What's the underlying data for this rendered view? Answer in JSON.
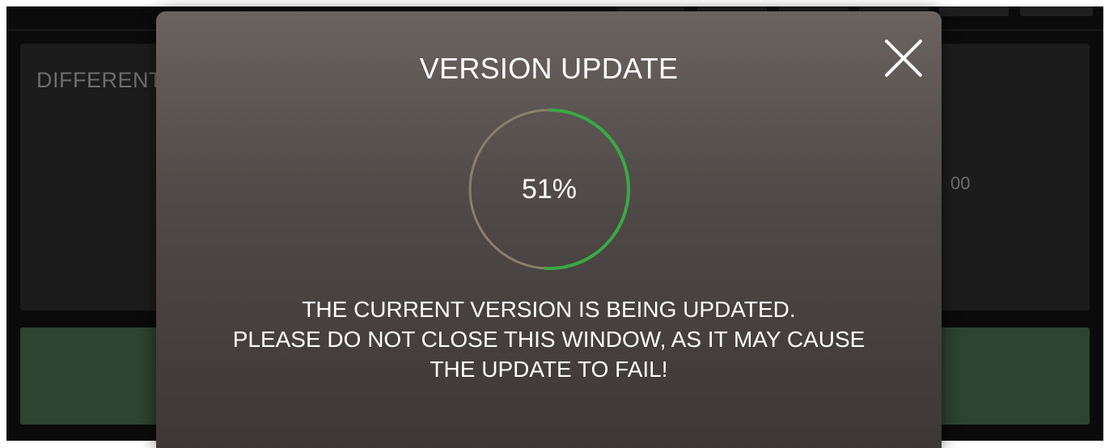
{
  "background": {
    "card_title": "DIFFERENT",
    "card_value": "00"
  },
  "modal": {
    "title": "VERSION UPDATE",
    "progress": {
      "percent": 51,
      "label": "51%",
      "track_color": "#8b7f6a",
      "fill_color": "#3aa945"
    },
    "message_lines": [
      "THE CURRENT VERSION IS BEING UPDATED.",
      "PLEASE DO NOT CLOSE THIS WINDOW, AS IT MAY CAUSE",
      "THE UPDATE TO FAIL!"
    ],
    "close_icon": "close-icon"
  }
}
